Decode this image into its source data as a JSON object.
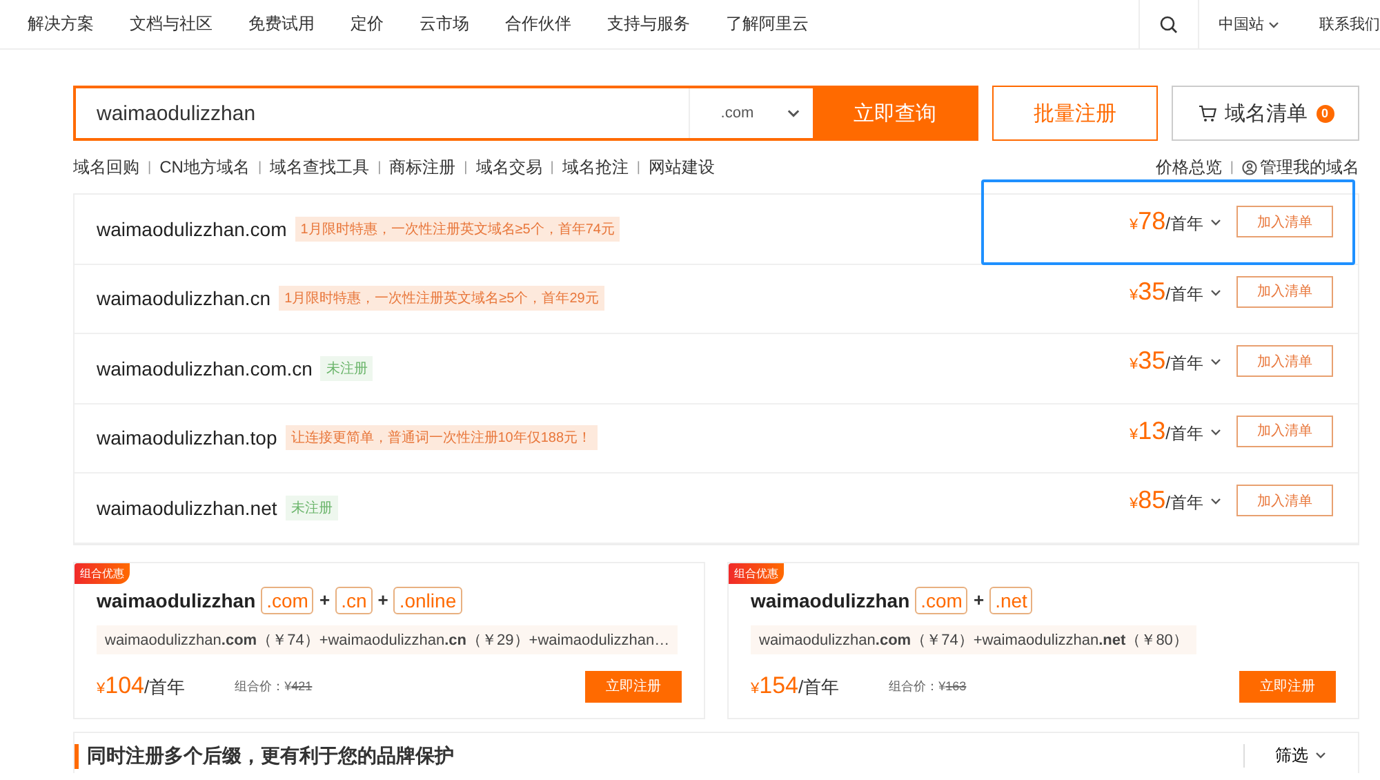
{
  "nav": {
    "items": [
      "解决方案",
      "文档与社区",
      "免费试用",
      "定价",
      "云市场",
      "合作伙伴",
      "支持与服务",
      "了解阿里云"
    ],
    "region": "中国站",
    "contact": "联系我们"
  },
  "search": {
    "value": "waimaodulizzhan",
    "suffix": ".com",
    "submit": "立即查询",
    "batch": "批量注册",
    "cart": "域名清单",
    "cart_count": "0"
  },
  "links": [
    {
      "label": "域名回购"
    },
    {
      "sep": "|",
      "label": "CN地方域名"
    },
    {
      "sep": "|",
      "label": "域名查找工具"
    },
    {
      "sep": "|",
      "label": "商标注册"
    },
    {
      "sep": "|",
      "label": "域名交易"
    },
    {
      "sep": "|",
      "label": "域名抢注"
    },
    {
      "sep": "|",
      "label": "网站建设"
    }
  ],
  "right_links": [
    {
      "label": "价格总览"
    },
    {
      "sep": "|",
      "label": "管理我的域名"
    }
  ],
  "results": [
    {
      "domain": "waimaodulizzhan.com",
      "tag": {
        "kind": "promo",
        "text": "1月限时特惠，一次性注册英文域名≥5个，首年74元"
      },
      "currency": "¥",
      "price": "78",
      "unit": "/首年",
      "button": "加入清单",
      "highlighted": true
    },
    {
      "domain": "waimaodulizzhan.cn",
      "tag": {
        "kind": "promo",
        "text": "1月限时特惠，一次性注册英文域名≥5个，首年29元"
      },
      "currency": "¥",
      "price": "35",
      "unit": "/首年",
      "button": "加入清单",
      "highlighted": false
    },
    {
      "domain": "waimaodulizzhan.com.cn",
      "tag": {
        "kind": "status",
        "text": "未注册"
      },
      "currency": "¥",
      "price": "35",
      "unit": "/首年",
      "button": "加入清单",
      "highlighted": false
    },
    {
      "domain": "waimaodulizzhan.top",
      "tag": {
        "kind": "promo",
        "text": "让连接更简单，普通词一次性注册10年仅188元！"
      },
      "currency": "¥",
      "price": "13",
      "unit": "/首年",
      "button": "加入清单",
      "highlighted": false
    },
    {
      "domain": "waimaodulizzhan.net",
      "tag": {
        "kind": "status",
        "text": "未注册"
      },
      "currency": "¥",
      "price": "85",
      "unit": "/首年",
      "button": "加入清单",
      "highlighted": false
    }
  ],
  "bundles": [
    {
      "badge": "组合优惠",
      "title": [
        {
          "kind": "name",
          "text": "waimaodulizzhan"
        },
        {
          "kind": "suffix",
          "text": ".com"
        },
        {
          "kind": "plus",
          "text": "+"
        },
        {
          "kind": "suffix",
          "text": ".cn"
        },
        {
          "kind": "plus",
          "text": "+"
        },
        {
          "kind": "suffix",
          "text": ".online"
        }
      ],
      "detail": "waimaodulizzhan**.com**（￥74）+waimaodulizzhan**.cn**（￥29）+waimaodulizzhan…",
      "currency": "¥",
      "price": "104",
      "unit": "/首年",
      "orig_label": "组合价：",
      "orig_currency": "¥",
      "orig_price": "421",
      "button": "立即注册"
    },
    {
      "badge": "组合优惠",
      "title": [
        {
          "kind": "name",
          "text": "waimaodulizzhan"
        },
        {
          "kind": "suffix",
          "text": ".com"
        },
        {
          "kind": "plus",
          "text": "+"
        },
        {
          "kind": "suffix",
          "text": ".net"
        }
      ],
      "detail": "waimaodulizzhan**.com**（￥74）+waimaodulizzhan**.net**（￥80）",
      "currency": "¥",
      "price": "154",
      "unit": "/首年",
      "orig_label": "组合价：",
      "orig_currency": "¥",
      "orig_price": "163",
      "button": "立即注册"
    }
  ],
  "bottom": {
    "heading": "同时注册多个后缀，更有利于您的品牌保护",
    "filter": "筛选"
  }
}
